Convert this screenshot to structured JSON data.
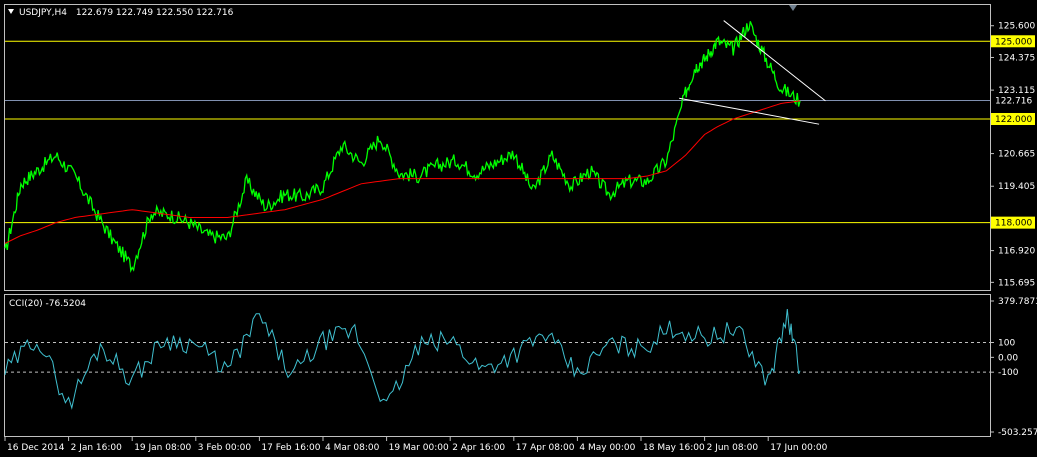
{
  "main_header": {
    "symbol": "USDJPY,H4",
    "ohlc": "122.679 122.749 122.550 122.716"
  },
  "cci_header": {
    "label": "CCI(20) -76.5204"
  },
  "colors": {
    "background": "#000000",
    "frame": "#c0c0c0",
    "price_series": "#00ff00",
    "moving_average": "#ff0000",
    "hline": "#ffff00",
    "hline_label_bg": "#ffff00",
    "current_price_line": "#8090b0",
    "trendline": "#ffffff",
    "cci_series": "#40c0d0",
    "cci_levels": "#c0c0c0"
  },
  "icons": {
    "header_arrow": "triangle-down-icon",
    "chart_shift_marker": "triangle-down-icon"
  },
  "chart_data": [
    {
      "type": "line",
      "panel": "price",
      "ylim": [
        115.4,
        126.4
      ],
      "y_ticks": [
        "125.600",
        "124.375",
        "123.115",
        "120.665",
        "119.405",
        "116.920",
        "115.695"
      ],
      "x_ticks": [
        "16 Dec 2014",
        "2 Jan 16:00",
        "19 Jan 08:00",
        "3 Feb 00:00",
        "17 Feb 16:00",
        "4 Mar 08:00",
        "19 Mar 00:00",
        "2 Apr 16:00",
        "17 Apr 08:00",
        "4 May 00:00",
        "18 May 16:00",
        "2 Jun 08:00",
        "17 Jun 00:00"
      ],
      "x": [
        0,
        0.25,
        0.5,
        0.8,
        1.1,
        1.4,
        1.7,
        2.0,
        2.3,
        2.6,
        2.9,
        3.2,
        3.5,
        3.8,
        4.1,
        4.4,
        4.7,
        5.0,
        5.3,
        5.6,
        5.9,
        6.2,
        6.5,
        6.8,
        7.1,
        7.4,
        7.7,
        8.0,
        8.3,
        8.6,
        8.9,
        9.2,
        9.5,
        9.8,
        10.1,
        10.4,
        10.7,
        10.85,
        11.0,
        11.2,
        11.45,
        11.7,
        11.95,
        12.2,
        12.5
      ],
      "series": [
        {
          "kind": "price",
          "values": [
            116.8,
            119.5,
            120.0,
            120.6,
            119.8,
            118.5,
            117.3,
            116.3,
            118.4,
            118.3,
            118.0,
            117.5,
            117.4,
            119.6,
            118.6,
            119.1,
            119.0,
            119.4,
            121.0,
            120.3,
            121.3,
            119.9,
            119.8,
            120.2,
            120.4,
            119.9,
            120.3,
            120.7,
            119.2,
            120.6,
            119.4,
            120.0,
            119.1,
            119.6,
            119.6,
            120.4,
            123.0,
            124.0,
            124.3,
            125.0,
            124.7,
            125.7,
            124.4,
            123.2,
            122.7
          ]
        },
        {
          "kind": "moving_average",
          "values": [
            117.2,
            117.5,
            117.7,
            118.0,
            118.2,
            118.3,
            118.4,
            118.5,
            118.4,
            118.3,
            118.2,
            118.2,
            118.2,
            118.3,
            118.4,
            118.5,
            118.7,
            118.9,
            119.2,
            119.5,
            119.6,
            119.7,
            119.7,
            119.7,
            119.7,
            119.7,
            119.7,
            119.7,
            119.7,
            119.7,
            119.7,
            119.7,
            119.7,
            119.7,
            119.8,
            120.0,
            120.6,
            121.0,
            121.4,
            121.7,
            122.0,
            122.2,
            122.4,
            122.6,
            122.7
          ]
        }
      ],
      "annotations": {
        "horizontal_levels": [
          {
            "value": 125.0,
            "label": "125.000"
          },
          {
            "value": 122.0,
            "label": "122.000"
          },
          {
            "value": 118.0,
            "label": "118.000"
          }
        ],
        "current_price": {
          "value": 122.716,
          "label": "122.716"
        },
        "trendlines": [
          {
            "from": [
              11.3,
              125.8
            ],
            "to": [
              12.9,
              122.7
            ]
          },
          {
            "from": [
              10.6,
              122.8
            ],
            "to": [
              12.8,
              121.8
            ]
          }
        ]
      }
    },
    {
      "type": "line",
      "panel": "indicator",
      "ylim": [
        -503.2579,
        379.7873
      ],
      "y_ticks": [
        "379.7873",
        "100",
        "0.00",
        "-100",
        "-503.2579"
      ],
      "x": [
        0,
        0.5,
        1.0,
        1.5,
        2.0,
        2.5,
        3.0,
        3.5,
        4.0,
        4.5,
        5.0,
        5.5,
        6.0,
        6.5,
        7.0,
        7.5,
        8.0,
        8.5,
        9.0,
        9.5,
        10.0,
        10.5,
        11.0,
        11.5,
        12.0,
        12.3,
        12.5
      ],
      "series": [
        {
          "kind": "cci",
          "values": [
            -100,
            140,
            -320,
            80,
            -150,
            120,
            90,
            -90,
            280,
            -130,
            110,
            180,
            -340,
            70,
            120,
            -80,
            20,
            160,
            -120,
            90,
            60,
            200,
            130,
            190,
            -160,
            280,
            -90
          ]
        }
      ],
      "levels": [
        100,
        -100
      ]
    }
  ]
}
